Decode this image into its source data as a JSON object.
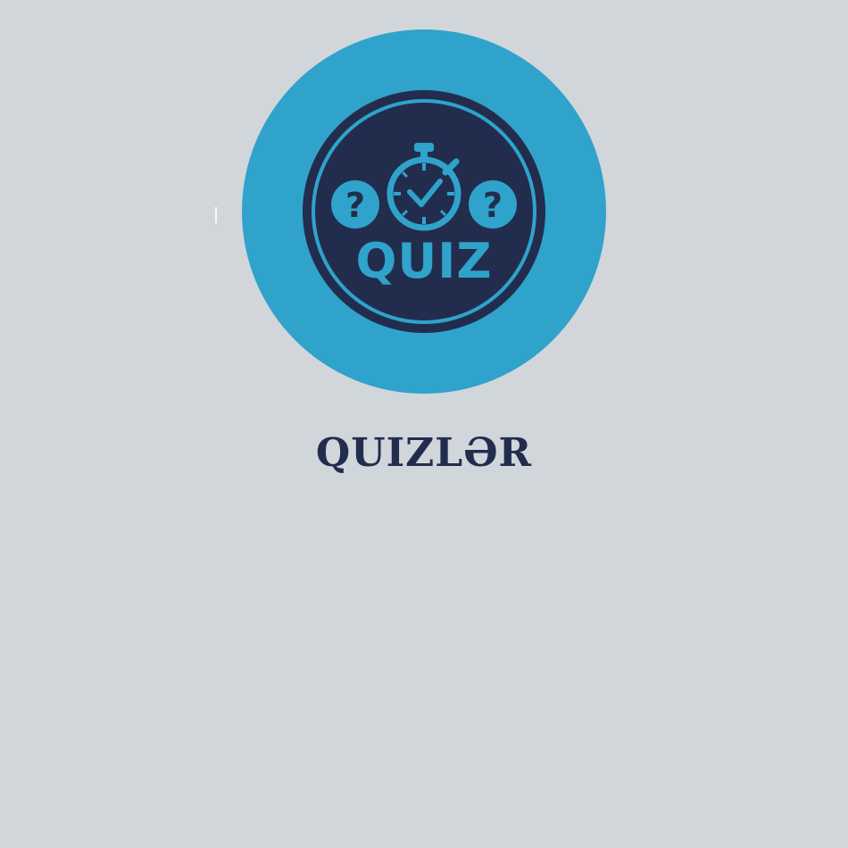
{
  "colors": {
    "background": "#d1d6db",
    "badge_outer": "#2fa3cb",
    "badge_inner": "#222d4e",
    "accent": "#2fa3cb",
    "title_text": "#222d4e"
  },
  "badge": {
    "label": "QUIZ",
    "question_mark_left": "?",
    "question_mark_right": "?",
    "icons": [
      "question-mark-icon",
      "stopwatch-icon",
      "checkmark-icon",
      "question-mark-icon"
    ]
  },
  "title": "QUIZLƏR"
}
